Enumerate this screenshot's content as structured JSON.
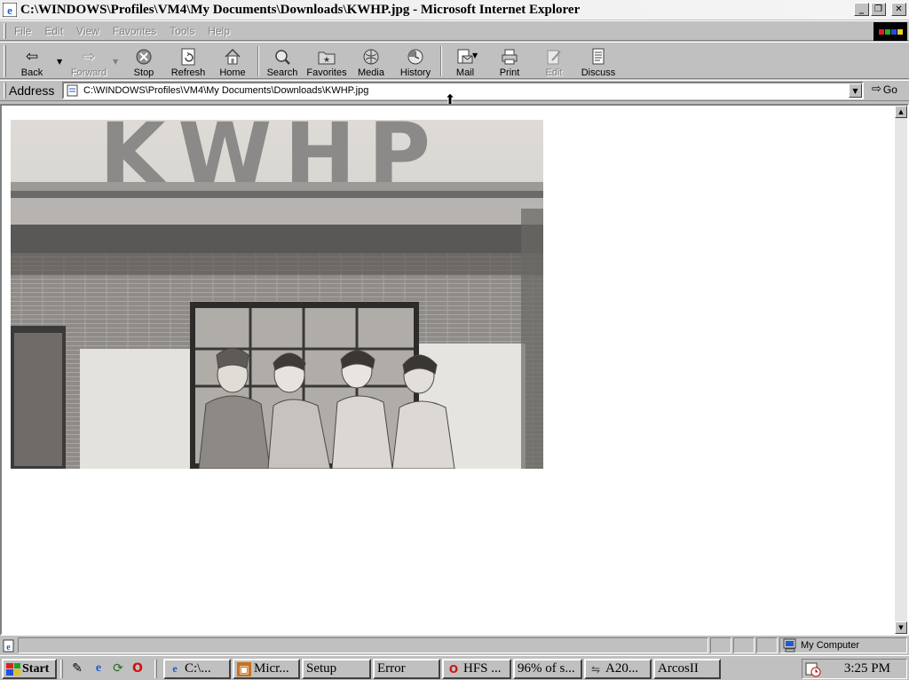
{
  "window": {
    "title": "C:\\WINDOWS\\Profiles\\VM4\\My Documents\\Downloads\\KWHP.jpg - Microsoft Internet Explorer",
    "minimize": "_",
    "restore": "❐",
    "close": "✕"
  },
  "menu": [
    "File",
    "Edit",
    "View",
    "Favorites",
    "Tools",
    "Help"
  ],
  "toolbar": {
    "back": "Back",
    "forward": "Forward",
    "stop": "Stop",
    "refresh": "Refresh",
    "home": "Home",
    "search": "Search",
    "favorites": "Favorites",
    "media": "Media",
    "history": "History",
    "mail": "Mail",
    "print": "Print",
    "edit": "Edit",
    "discuss": "Discuss"
  },
  "address": {
    "label": "Address",
    "value": "C:\\WINDOWS\\Profiles\\VM4\\My Documents\\Downloads\\KWHP.jpg",
    "go": "Go"
  },
  "photo": {
    "sign_text": "KWHP"
  },
  "status": {
    "zone": "My Computer"
  },
  "taskbar": {
    "start": "Start",
    "tasks": [
      "C:\\...",
      "Micr...",
      "Setup",
      "Error",
      "HFS ...",
      "96% of s...",
      "A20...",
      "ArcosII"
    ],
    "clock": "3:25 PM"
  },
  "colors": {
    "face": "#c0c0c0",
    "content_bg": "#ffffff",
    "ie_blue": "#1c5bd6"
  }
}
